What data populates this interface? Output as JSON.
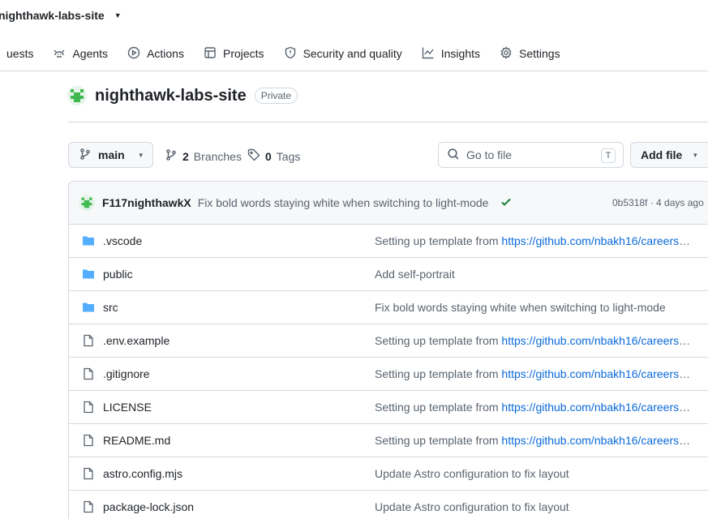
{
  "repo_crumb": {
    "name": "nighthawk-labs-site"
  },
  "nav": {
    "tabs": [
      {
        "label": "uests",
        "icon": "pull-request-icon"
      },
      {
        "label": "Agents",
        "icon": "agents-icon"
      },
      {
        "label": "Actions",
        "icon": "play-icon"
      },
      {
        "label": "Projects",
        "icon": "table-icon"
      },
      {
        "label": "Security and quality",
        "icon": "shield-icon"
      },
      {
        "label": "Insights",
        "icon": "graph-icon"
      },
      {
        "label": "Settings",
        "icon": "gear-icon"
      }
    ]
  },
  "repo": {
    "name": "nighthawk-labs-site",
    "visibility": "Private"
  },
  "toolbar": {
    "branch": "main",
    "branches_count": "2",
    "branches_label": "Branches",
    "tags_count": "0",
    "tags_label": "Tags",
    "search_placeholder": "Go to file",
    "search_shortcut": "T",
    "add_file_label": "Add file"
  },
  "commit": {
    "author": "F117nighthawkX",
    "message": "Fix bold words staying white when switching to light-mode",
    "meta": "0b5318f · 4 days ago",
    "status": "success"
  },
  "files": [
    {
      "type": "folder",
      "name": ".vscode",
      "msg": "Setting up template from ",
      "link": "https://github.com/nbakh16/careers-portfolio"
    },
    {
      "type": "folder",
      "name": "public",
      "msg": "Add self-portrait",
      "link": ""
    },
    {
      "type": "folder",
      "name": "src",
      "msg": "Fix bold words staying white when switching to light-mode",
      "link": ""
    },
    {
      "type": "file",
      "name": ".env.example",
      "msg": "Setting up template from ",
      "link": "https://github.com/nbakh16/careers-portfolio"
    },
    {
      "type": "file",
      "name": ".gitignore",
      "msg": "Setting up template from ",
      "link": "https://github.com/nbakh16/careers-portfolio"
    },
    {
      "type": "file",
      "name": "LICENSE",
      "msg": "Setting up template from ",
      "link": "https://github.com/nbakh16/careers-portfolio"
    },
    {
      "type": "file",
      "name": "README.md",
      "msg": "Setting up template from ",
      "link": "https://github.com/nbakh16/careers-portfolio"
    },
    {
      "type": "file",
      "name": "astro.config.mjs",
      "msg": "Update Astro configuration to fix layout",
      "link": ""
    },
    {
      "type": "file",
      "name": "package-lock.json",
      "msg": "Update Astro configuration to fix layout",
      "link": ""
    }
  ],
  "colors": {
    "accent_link": "#0969da",
    "success": "#1a7f37",
    "folder": "#54aeff",
    "avatar_green": "#3fb950"
  }
}
